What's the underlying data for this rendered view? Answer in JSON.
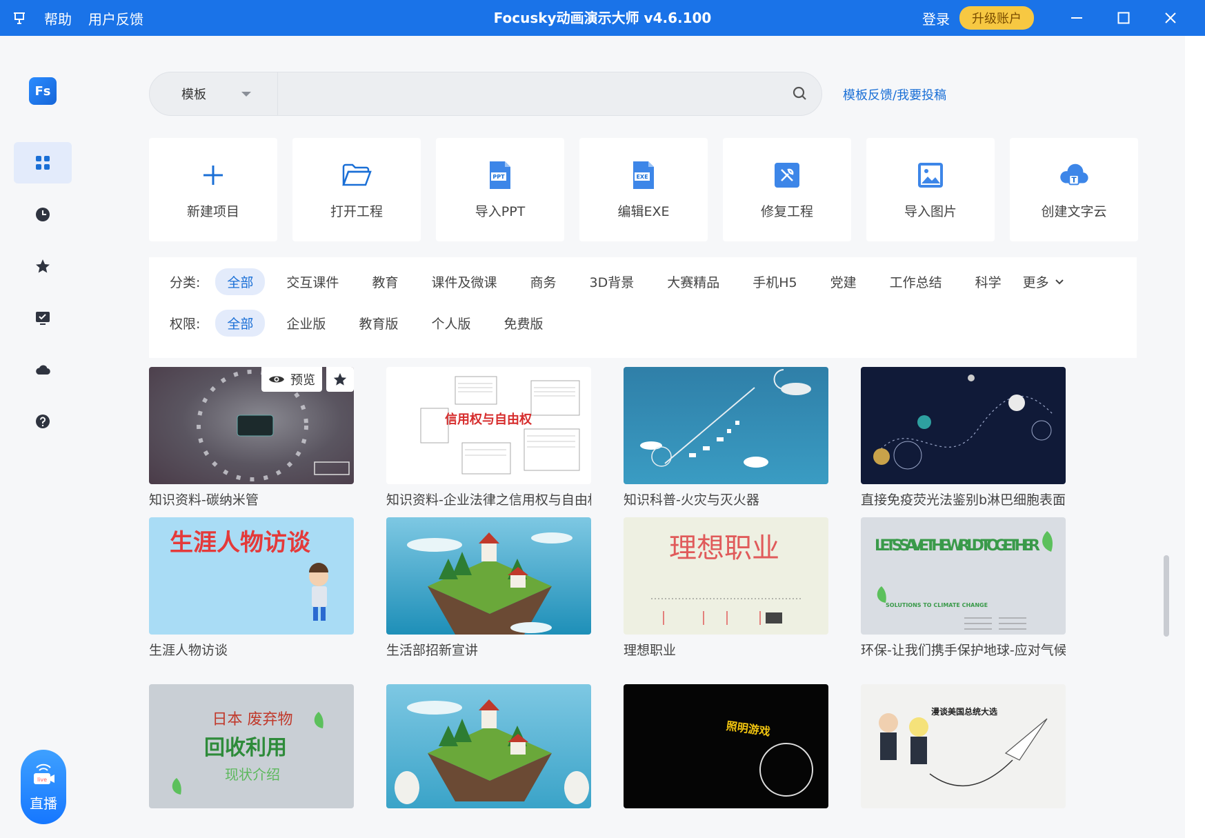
{
  "app": {
    "title": "Focusky动画演示大师 v4.6.100",
    "menu": [
      "帮助",
      "用户反馈"
    ],
    "login": "登录",
    "upgrade": "升级账户"
  },
  "sidebar": {
    "logo": "Fs",
    "items": [
      {
        "icon": "grid-icon",
        "active": true
      },
      {
        "icon": "clock-icon",
        "active": false
      },
      {
        "icon": "star-icon",
        "active": false
      },
      {
        "icon": "monitor-check-icon",
        "active": false
      },
      {
        "icon": "cloud-icon",
        "active": false
      },
      {
        "icon": "help-icon",
        "active": false
      }
    ],
    "live": {
      "badge": "live",
      "label": "直播"
    }
  },
  "search": {
    "category": "模板",
    "value": "",
    "feedback_link": "模板反馈/我要投稿"
  },
  "actions": [
    {
      "label": "新建项目",
      "icon": "plus-icon"
    },
    {
      "label": "打开工程",
      "icon": "folder-open-icon"
    },
    {
      "label": "导入PPT",
      "icon": "ppt-file-icon",
      "badge": "PPT"
    },
    {
      "label": "编辑EXE",
      "icon": "exe-file-icon",
      "badge": "EXE"
    },
    {
      "label": "修复工程",
      "icon": "repair-tools-icon"
    },
    {
      "label": "导入图片",
      "icon": "image-icon"
    },
    {
      "label": "创建文字云",
      "icon": "text-cloud-icon",
      "badge": "T"
    }
  ],
  "filters": {
    "category_label": "分类:",
    "categories": [
      "全部",
      "交互课件",
      "教育",
      "课件及微课",
      "商务",
      "3D背景",
      "大赛精品",
      "手机H5",
      "党建",
      "工作总结",
      "科学"
    ],
    "more": "更多",
    "permission_label": "权限:",
    "permissions": [
      "全部",
      "企业版",
      "教育版",
      "个人版",
      "免费版"
    ]
  },
  "overlay": {
    "preview": "预览"
  },
  "templates": [
    {
      "name": "知识资料-碳纳米管",
      "style": "carbon"
    },
    {
      "name": "知识资料-企业法律之信用权与自由权",
      "style": "law",
      "text": "信用权与自由权"
    },
    {
      "name": "知识科普-火灾与灭火器",
      "style": "fire"
    },
    {
      "name": "直接免疫荧光法鉴别b淋巴细胞表面",
      "style": "space"
    },
    {
      "name": "生涯人物访谈",
      "style": "career",
      "text": "生涯人物访谈"
    },
    {
      "name": "生活部招新宣讲",
      "style": "island"
    },
    {
      "name": "理想职业",
      "style": "ideal",
      "text": "理想职业"
    },
    {
      "name": "环保-让我们携手保护地球-应对气候变化",
      "style": "eco",
      "text": "LET'S SAVE THE WR LD TOGETHER",
      "subtext": "SOLUTIONS TO CLIMATE CHANGE"
    },
    {
      "name": "",
      "style": "recycle",
      "text": "日本 废弃物",
      "text2": "回收利用",
      "text3": "现状介绍"
    },
    {
      "name": "",
      "style": "island2"
    },
    {
      "name": "",
      "style": "dark",
      "text": "照明游戏"
    },
    {
      "name": "",
      "style": "paper",
      "text": "漫谈美国总统大选"
    }
  ],
  "colors": {
    "titlebar": "#1a73e8",
    "accent": "#1a6fd6",
    "upgrade": "#f7c842"
  }
}
